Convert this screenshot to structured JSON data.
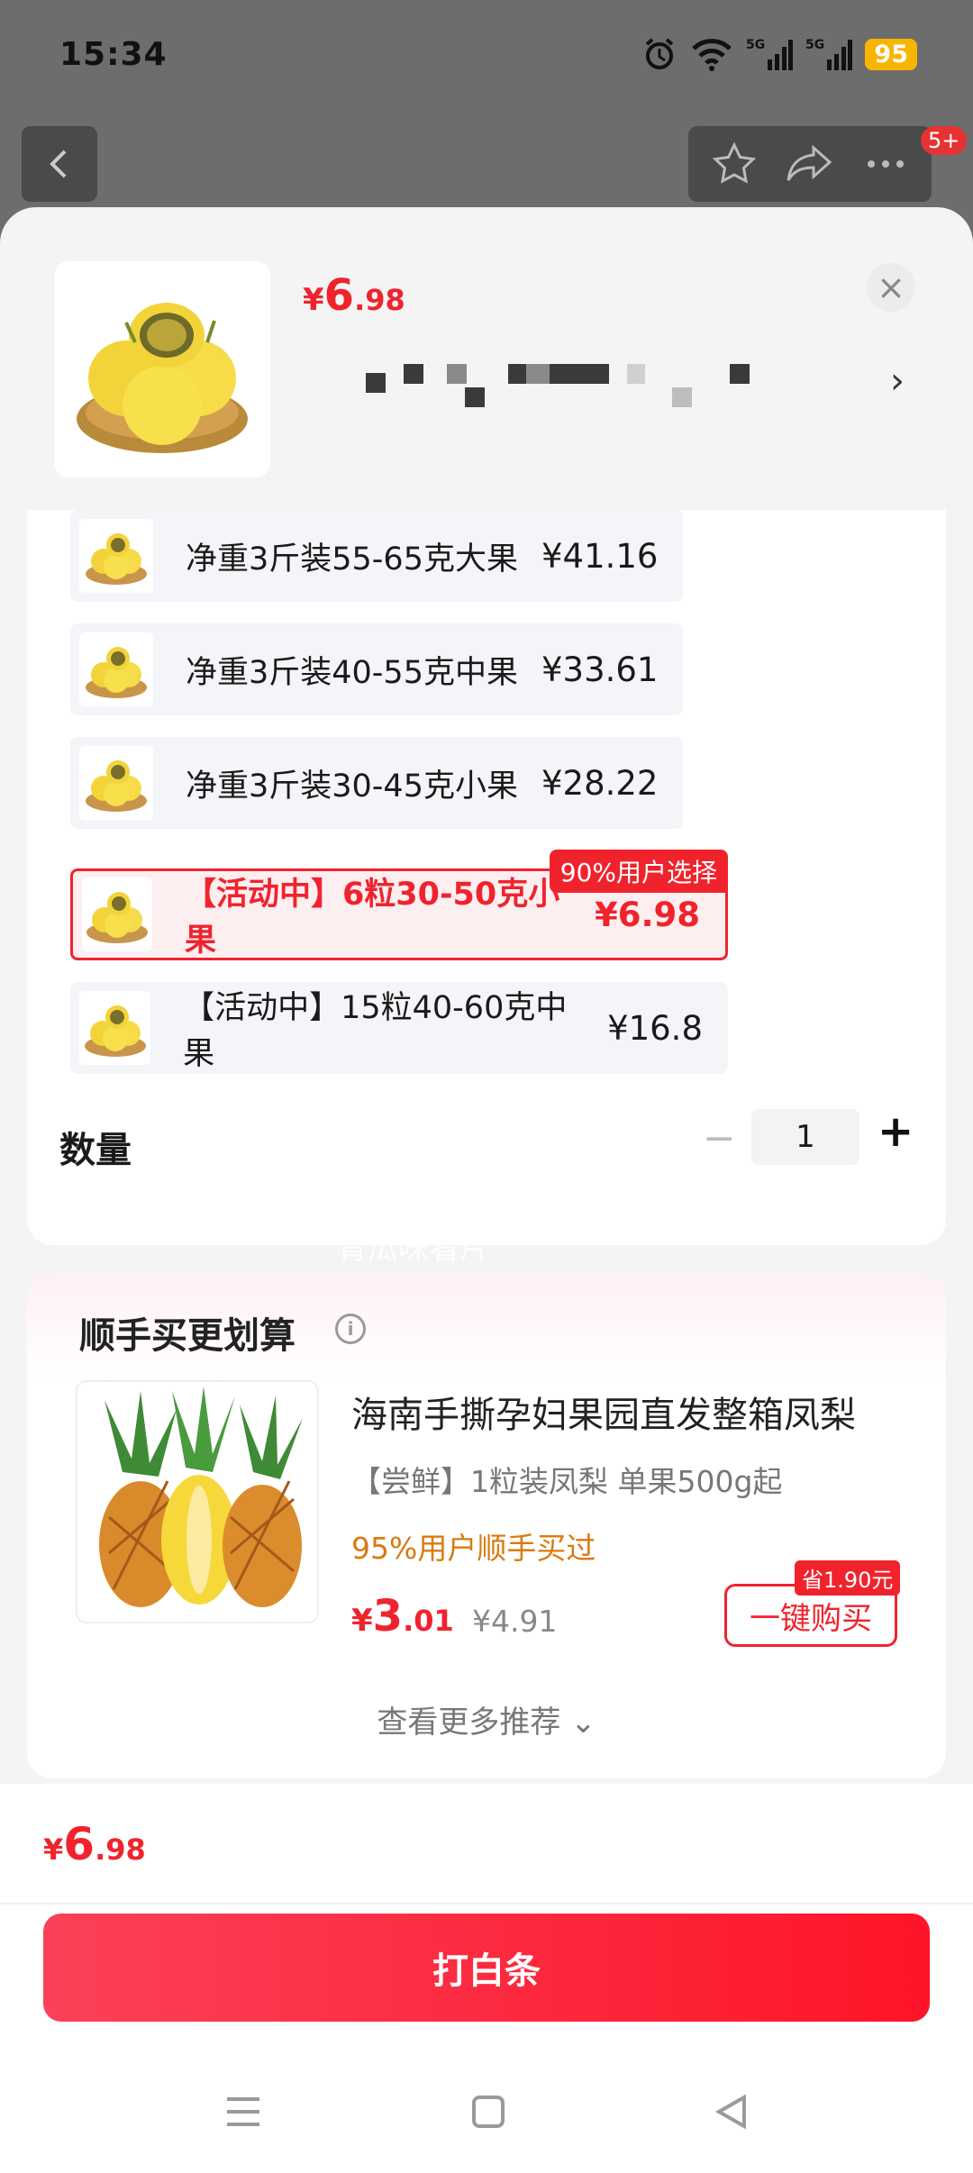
{
  "status": {
    "time": "15:34",
    "battery": "95",
    "network": "5G"
  },
  "nav": {
    "badge": "5+"
  },
  "product": {
    "price": {
      "currency": "¥",
      "int": "6",
      "dec": ".98"
    },
    "close": "×",
    "chevron": "›"
  },
  "options": [
    {
      "label": "净重3斤装55-65克大果",
      "price": "¥41.16"
    },
    {
      "label": "净重3斤装40-55克中果",
      "price": "¥33.61"
    },
    {
      "label": "净重3斤装30-45克小果",
      "price": "¥28.22"
    },
    {
      "label": "【活动中】6粒30-50克小果",
      "price": "¥6.98",
      "tag": "90%用户选择"
    },
    {
      "label": "【活动中】15粒40-60克中果",
      "price": "¥16.8"
    }
  ],
  "watermark": "青瓜味看片",
  "quantity": {
    "label": "数量",
    "minus": "−",
    "value": "1",
    "plus": "+"
  },
  "recommend": {
    "title": "顺手买更划算",
    "name": "海南手撕孕妇果园直发整箱凤梨",
    "sub": "【尝鲜】1粒装凤梨 单果500g起",
    "hint": "95%用户顺手买过",
    "price": {
      "currency": "¥",
      "int": "3",
      "dec": ".01"
    },
    "old_price": "¥4.91",
    "save_tag": "省1.90元",
    "buy_label": "一键购买",
    "more": "查看更多推荐 ⌄"
  },
  "footer": {
    "price": {
      "currency": "¥",
      "int": "6",
      "dec": ".98"
    },
    "cta": "打白条"
  },
  "colors": {
    "accent": "#f0232d",
    "hint": "#d97a10",
    "battery": "#f7b500"
  }
}
